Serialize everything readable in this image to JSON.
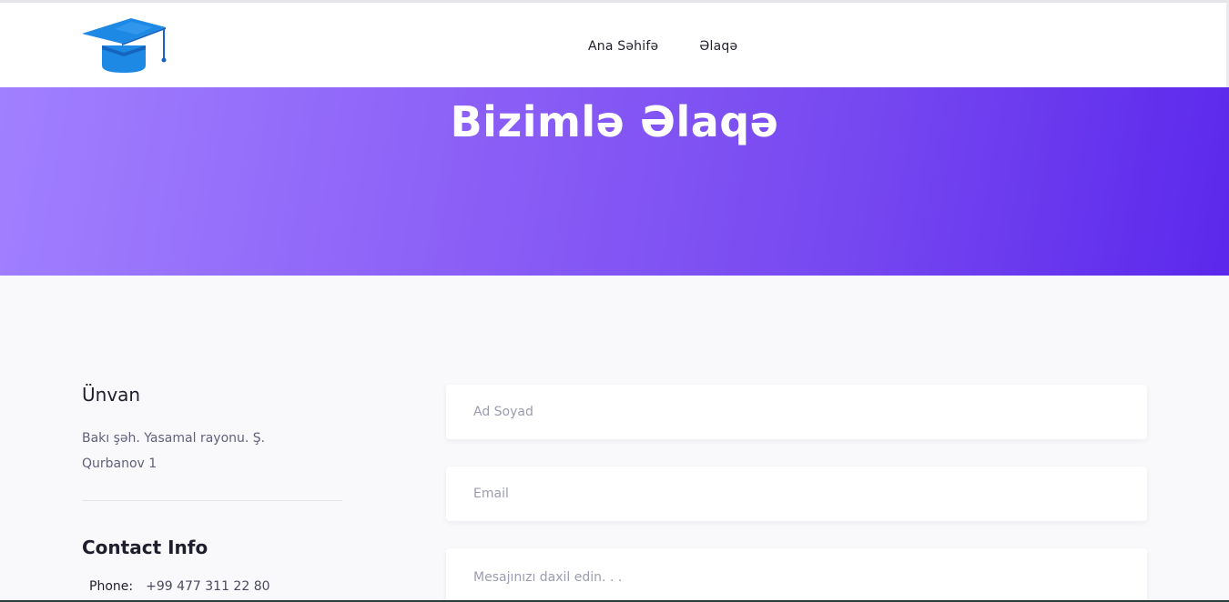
{
  "header": {
    "nav": [
      {
        "label": "Ana Səhifə"
      },
      {
        "label": "Əlaqə"
      }
    ]
  },
  "hero": {
    "title": "Bizimlə Əlaqə"
  },
  "info": {
    "address_heading": "Ünvan",
    "address_line1": "Bakı şəh. Yasamal rayonu. Ş.",
    "address_line2": "Qurbanov 1",
    "contact_heading": "Contact Info",
    "phone_label": "Phone:",
    "phone_value": "+99 477 311 22 80"
  },
  "form": {
    "name_placeholder": "Ad Soyad",
    "email_placeholder": "Email",
    "message_placeholder": "Mesajınızı daxil edin. . ."
  },
  "colors": {
    "hero_gradient_start": "#a180ff",
    "hero_gradient_end": "#5b28ec",
    "logo_blue": "#1e88e5"
  }
}
